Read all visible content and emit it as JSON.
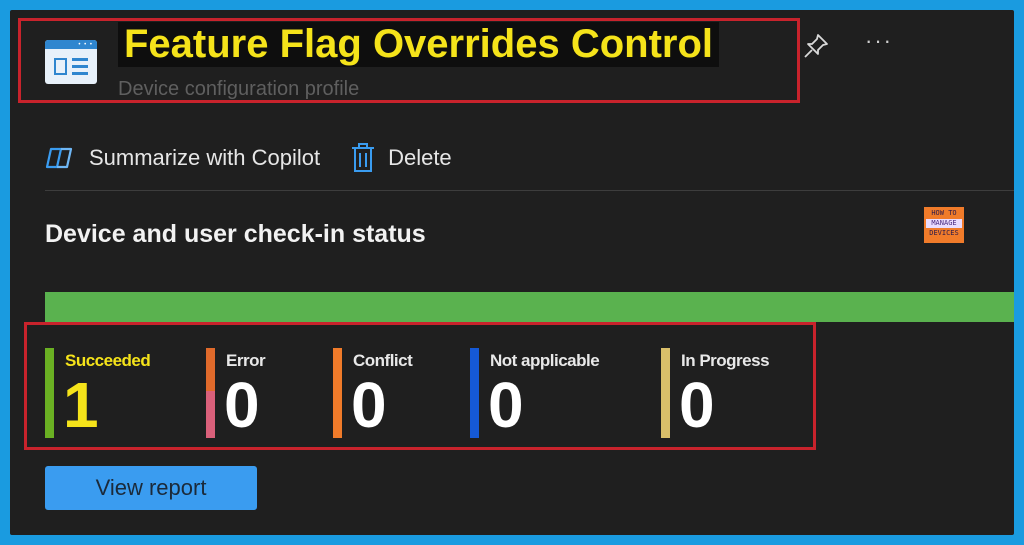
{
  "header": {
    "title": "Feature Flag Overrides Control",
    "subtitle": "Device configuration profile",
    "more_label": "···"
  },
  "toolbar": {
    "copilot_label": "Summarize with Copilot",
    "delete_label": "Delete"
  },
  "section": {
    "title": "Device and user check-in status"
  },
  "logo": {
    "line1": "HOW TO",
    "line2": "MANAGE",
    "line3": "DEVICES"
  },
  "stats": [
    {
      "label": "Succeeded",
      "value": "1",
      "color": "#6ab023"
    },
    {
      "label": "Error",
      "value": "0",
      "color": "#e06a2b"
    },
    {
      "label": "Conflict",
      "value": "0",
      "color": "#f07b2a"
    },
    {
      "label": "Not applicable",
      "value": "0",
      "color": "#1559d6"
    },
    {
      "label": "In Progress",
      "value": "0",
      "color": "#d9bf6a"
    }
  ],
  "actions": {
    "view_report_label": "View report"
  },
  "colors": {
    "accent": "#1a9be0",
    "title_highlight": "#f5e31a",
    "status_bar": "#5ab24f",
    "annotation_red": "#c8232c"
  }
}
